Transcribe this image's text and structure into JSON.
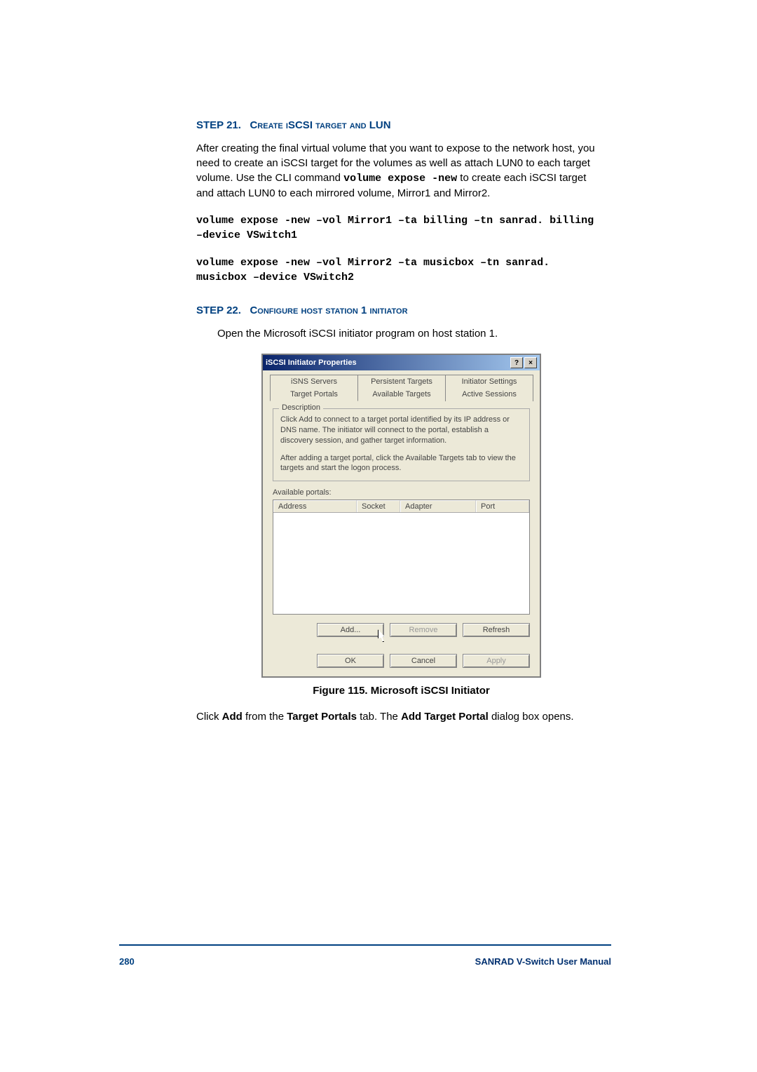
{
  "step21": {
    "label": "STEP 21.",
    "title": "Create iSCSI target and LUN",
    "para_before": "After creating the final virtual volume that you want to expose to the network host, you need to create an iSCSI target for the volumes as well as attach LUN0 to each target volume.  Use the CLI command ",
    "cmd_inline": "volume expose -new",
    "para_after": " to create each iSCSI target and attach LUN0 to each mirrored volume, Mirror1 and Mirror2.",
    "cmd1": "volume expose -new –vol Mirror1 –ta billing –tn sanrad. billing –device VSwitch1",
    "cmd2": "volume expose -new –vol Mirror2 –ta musicbox –tn sanrad. musicbox –device VSwitch2"
  },
  "step22": {
    "label": "STEP 22.",
    "title": "Configure host station 1 initiator",
    "para": "Open the Microsoft iSCSI initiator program on host station 1."
  },
  "dialog": {
    "title": "iSCSI Initiator Properties",
    "help_btn": "?",
    "close_btn": "×",
    "tabs_top": [
      "iSNS Servers",
      "Persistent Targets",
      "Initiator Settings"
    ],
    "tabs_bottom": [
      "Target Portals",
      "Available Targets",
      "Active Sessions"
    ],
    "active_tab": "Target Portals",
    "desc_legend": "Description",
    "desc1": "Click Add to connect to a target portal identified by its IP address or DNS name. The initiator will connect to the portal, establish a discovery session, and gather target information.",
    "desc2": "After adding a target portal, click the Available Targets tab to view the targets and start the logon process.",
    "available_label": "Available portals:",
    "columns": {
      "address": "Address",
      "socket": "Socket",
      "adapter": "Adapter",
      "port": "Port"
    },
    "buttons": {
      "add": "Add...",
      "remove": "Remove",
      "refresh": "Refresh",
      "ok": "OK",
      "cancel": "Cancel",
      "apply": "Apply"
    }
  },
  "figure": {
    "caption": "Figure 115.   Microsoft iSCSI Initiator"
  },
  "closing": {
    "pre": "Click ",
    "b1": "Add",
    "mid1": " from the ",
    "b2": "Target Portals",
    "mid2": " tab.  The ",
    "b3": "Add Target Portal",
    "post": " dialog box opens."
  },
  "footer": {
    "page": "280",
    "manual": "SANRAD V-Switch User Manual"
  }
}
